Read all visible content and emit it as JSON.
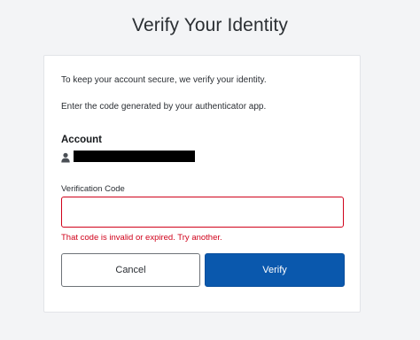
{
  "page": {
    "title": "Verify Your Identity"
  },
  "card": {
    "intro": "To keep your account secure, we verify your identity.",
    "instruction": "Enter the code generated by your authenticator app.",
    "account_heading": "Account",
    "account_value_redacted": true,
    "account_icon": "user-icon",
    "code_label": "Verification Code",
    "code_value": "",
    "error": "That code is invalid or expired. Try another.",
    "cancel_label": "Cancel",
    "verify_label": "Verify"
  },
  "colors": {
    "background": "#f3f4f6",
    "error": "#d0021b",
    "primary": "#0a58ad"
  }
}
